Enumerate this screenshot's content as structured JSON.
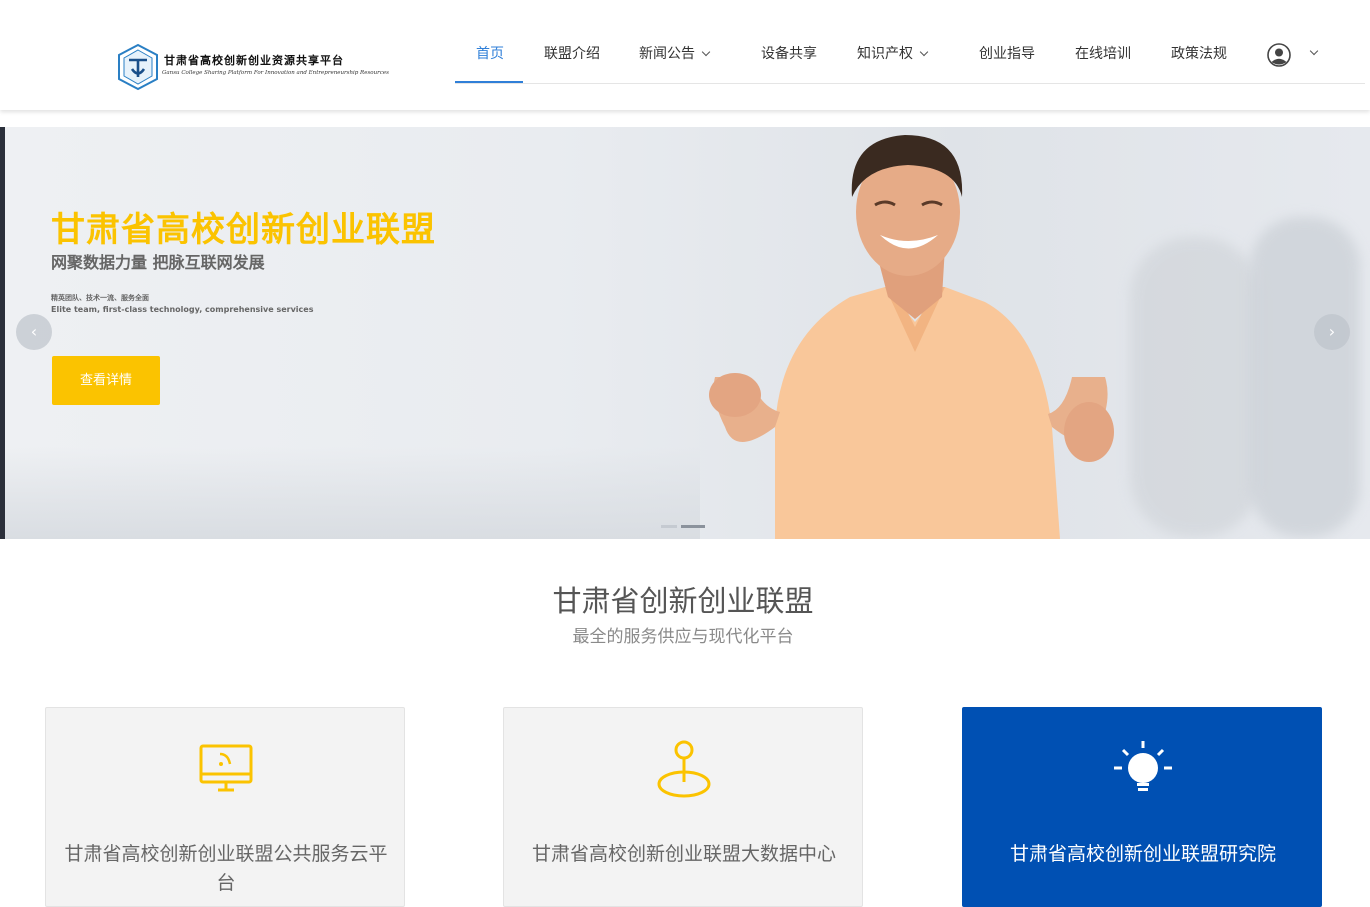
{
  "logo": {
    "title": "甘肃省高校创新创业资源共享平台",
    "subtitle": "Gansu College Sharing Platform For Innovation and Entrepreneurship Resources"
  },
  "nav": {
    "items": [
      {
        "label": "首页",
        "active": true
      },
      {
        "label": "联盟介绍"
      },
      {
        "label": "新闻公告",
        "has_dropdown": true
      },
      {
        "label": "设备共享"
      },
      {
        "label": "知识产权",
        "has_dropdown": true
      },
      {
        "label": "创业指导"
      },
      {
        "label": "在线培训"
      },
      {
        "label": "政策法规"
      }
    ],
    "user_icon": "user-circle-icon"
  },
  "hero": {
    "title": "甘肃省高校创新创业联盟",
    "subtitle": "网聚数据力量 把脉互联网发展",
    "tagline_cn": "精英团队、技术一流、服务全面",
    "tagline_en": "Elite team, first-class technology, comprehensive services",
    "button_label": "查看详情",
    "prev_arrow": "‹",
    "next_arrow": "›",
    "slides_total": 2,
    "active_slide": 2
  },
  "section": {
    "title": "甘肃省创新创业联盟",
    "subtitle": "最全的服务供应与现代化平台"
  },
  "cards": [
    {
      "label": "甘肃省高校创新创业联盟公共服务云平台",
      "icon": "monitor-icon"
    },
    {
      "label": "甘肃省高校创新创业联盟大数据中心",
      "icon": "map-pin-icon"
    },
    {
      "label": "甘肃省高校创新创业联盟研究院",
      "icon": "lightbulb-icon"
    }
  ],
  "colors": {
    "accent_blue": "#2f7fd8",
    "hero_yellow": "#fbc300",
    "card_blue": "#0050b3"
  }
}
